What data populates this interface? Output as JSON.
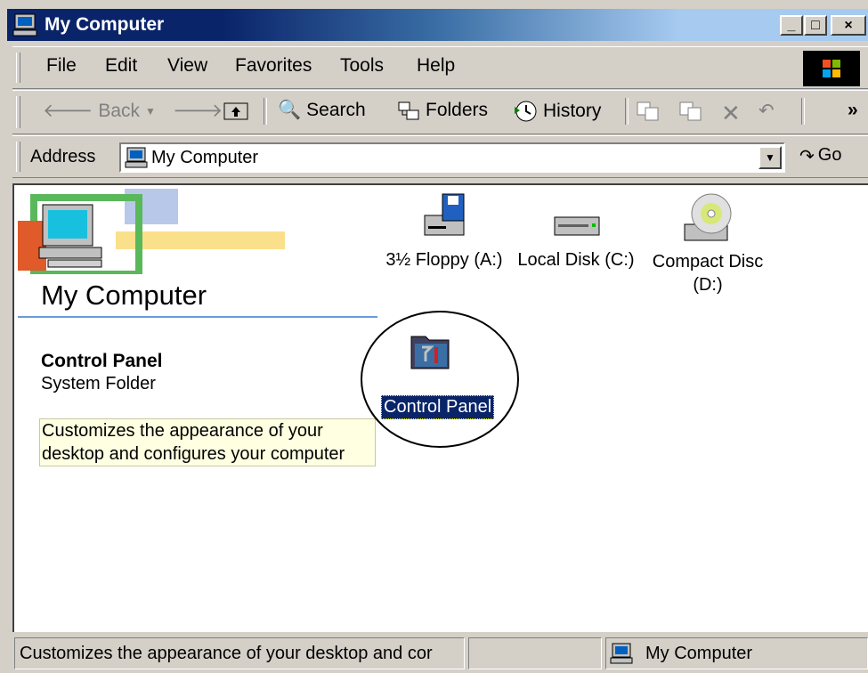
{
  "window": {
    "title": "My Computer",
    "caption_buttons": [
      "_",
      "□",
      "×"
    ]
  },
  "menu": {
    "items": [
      "File",
      "Edit",
      "View",
      "Favorites",
      "Tools",
      "Help"
    ]
  },
  "toolbar": {
    "back_label": "Back",
    "search_label": "Search",
    "folders_label": "Folders",
    "history_label": "History",
    "more": "»"
  },
  "address": {
    "label": "Address",
    "value": "My Computer",
    "go_label": "Go"
  },
  "left_pane": {
    "title": "My Computer",
    "selection_name": "Control Panel",
    "selection_type": "System Folder",
    "tip": "Customizes the appearance of your desktop and configures your computer"
  },
  "items": [
    {
      "label": "3½ Floppy (A:)",
      "icon": "floppy-drive-icon"
    },
    {
      "label": "Local Disk (C:)",
      "icon": "hard-disk-icon"
    },
    {
      "label": "Compact Disc (D:)",
      "icon": "cd-drive-icon"
    },
    {
      "label": "Control Panel",
      "icon": "control-panel-icon",
      "selected": true
    }
  ],
  "status": {
    "text": "Customizes the appearance of your desktop and cor",
    "location": "My Computer"
  },
  "colors": {
    "title_active": "#0a246a",
    "selection": "#0a246a",
    "tooltip_bg": "#ffffe1",
    "face": "#d4d0c8"
  }
}
